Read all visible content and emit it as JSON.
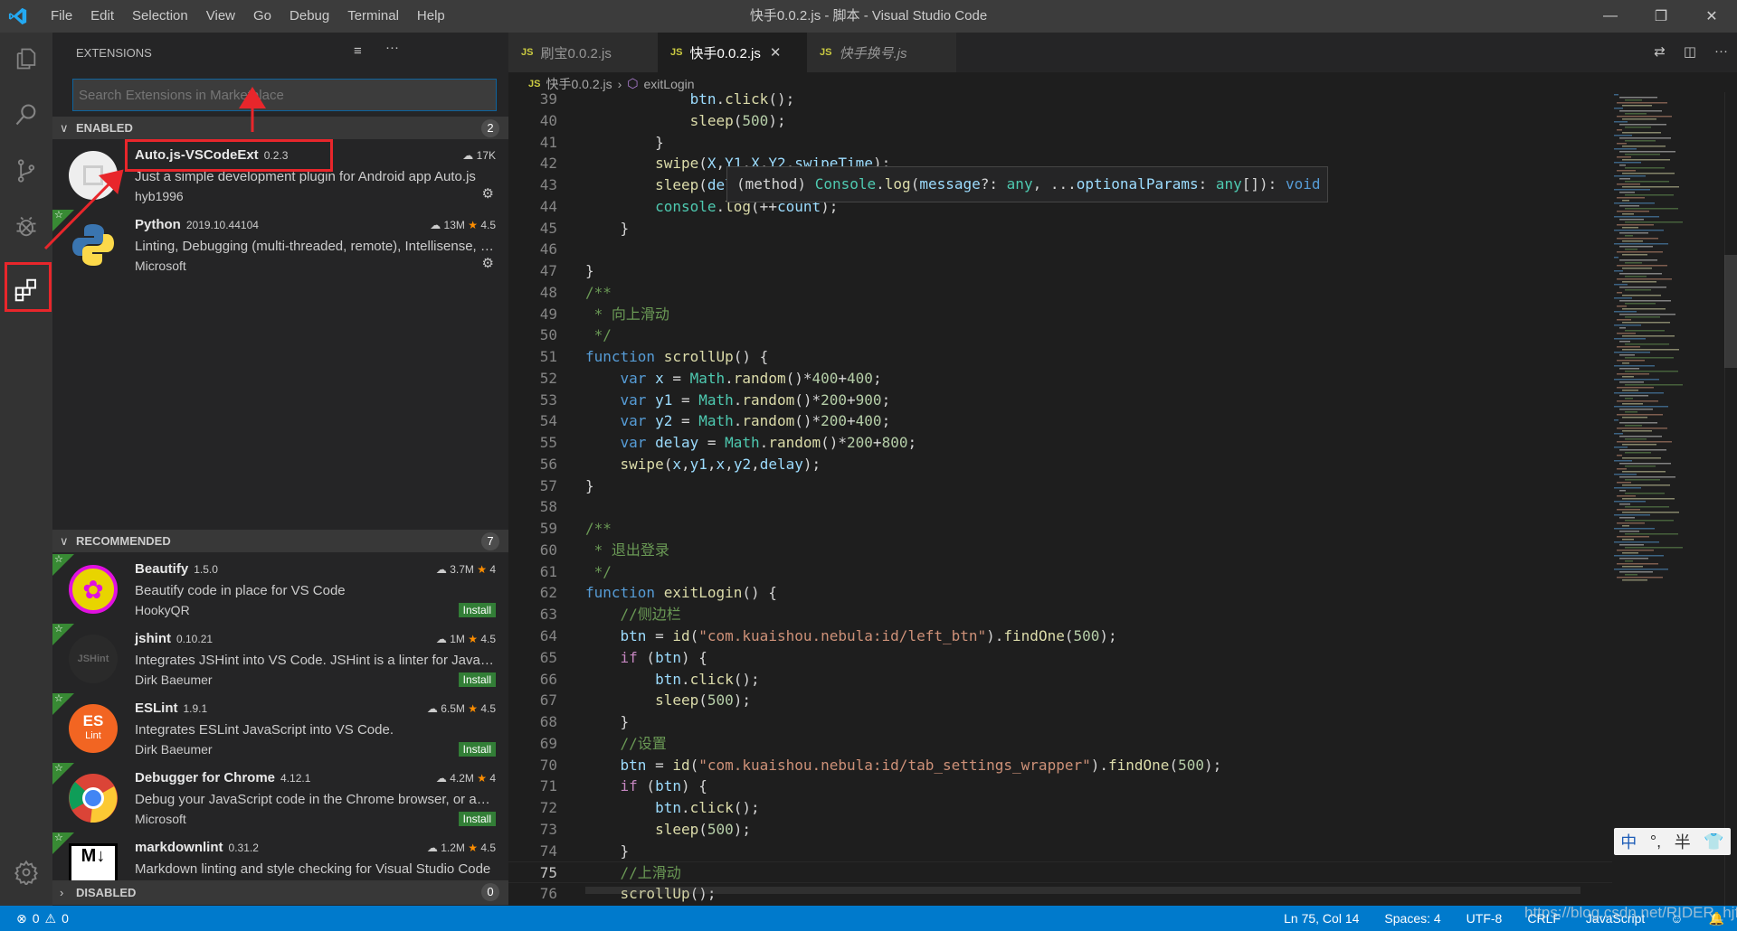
{
  "titlebar": {
    "menu": [
      "File",
      "Edit",
      "Selection",
      "View",
      "Go",
      "Debug",
      "Terminal",
      "Help"
    ],
    "title": "快手0.0.2.js - 脚本 - Visual Studio Code"
  },
  "sidebar": {
    "title": "EXTENSIONS",
    "search_placeholder": "Search Extensions in Marketplace",
    "enabled": {
      "label": "ENABLED",
      "count": "2",
      "items": [
        {
          "name": "Auto.js-VSCodeExt",
          "version": "0.2.3",
          "desc": "Just a simple development plugin for Android app Auto.js",
          "publisher": "hyb1996",
          "downloads": "17K",
          "rating": "",
          "action": "gear",
          "icon": "autojs",
          "recommended": false
        },
        {
          "name": "Python",
          "version": "2019.10.44104",
          "desc": "Linting, Debugging (multi-threaded, remote), Intellisense, code formatting",
          "publisher": "Microsoft",
          "downloads": "13M",
          "rating": "4.5",
          "action": "gear",
          "icon": "python",
          "recommended": true
        }
      ]
    },
    "recommended": {
      "label": "RECOMMENDED",
      "count": "7",
      "items": [
        {
          "name": "Beautify",
          "version": "1.5.0",
          "desc": "Beautify code in place for VS Code",
          "publisher": "HookyQR",
          "downloads": "3.7M",
          "rating": "4",
          "action": "Install",
          "icon": "beautify",
          "recommended": true
        },
        {
          "name": "jshint",
          "version": "0.10.21",
          "desc": "Integrates JSHint into VS Code. JSHint is a linter for JavaScript",
          "publisher": "Dirk Baeumer",
          "downloads": "1M",
          "rating": "4.5",
          "action": "Install",
          "icon": "jshint",
          "recommended": true
        },
        {
          "name": "ESLint",
          "version": "1.9.1",
          "desc": "Integrates ESLint JavaScript into VS Code.",
          "publisher": "Dirk Baeumer",
          "downloads": "6.5M",
          "rating": "4.5",
          "action": "Install",
          "icon": "eslint",
          "recommended": true
        },
        {
          "name": "Debugger for Chrome",
          "version": "4.12.1",
          "desc": "Debug your JavaScript code in the Chrome browser, or any other target",
          "publisher": "Microsoft",
          "downloads": "4.2M",
          "rating": "4",
          "action": "Install",
          "icon": "chrome",
          "recommended": true
        },
        {
          "name": "markdownlint",
          "version": "0.31.2",
          "desc": "Markdown linting and style checking for Visual Studio Code",
          "publisher": "",
          "downloads": "1.2M",
          "rating": "4.5",
          "action": "",
          "icon": "markdown",
          "recommended": true
        }
      ]
    },
    "disabled": {
      "label": "DISABLED",
      "count": "0"
    }
  },
  "editor": {
    "tabs": [
      {
        "label": "刷宝0.0.2.js",
        "active": false,
        "preview": false
      },
      {
        "label": "快手0.0.2.js",
        "active": true,
        "preview": false
      },
      {
        "label": "快手换号.js",
        "active": false,
        "preview": true
      }
    ],
    "breadcrumb": {
      "file": "快手0.0.2.js",
      "symbol": "exitLogin"
    },
    "current_line": 75,
    "tooltip": [
      [
        "p",
        "(method) "
      ],
      [
        "cl",
        "Console"
      ],
      [
        "p",
        "."
      ],
      [
        "f",
        "log"
      ],
      [
        "p",
        "("
      ],
      [
        "v",
        "message"
      ],
      [
        "p",
        "?: "
      ],
      [
        "cl",
        "any"
      ],
      [
        "p",
        ", ..."
      ],
      [
        "v",
        "optionalParams"
      ],
      [
        "p",
        ": "
      ],
      [
        "cl",
        "any"
      ],
      [
        "p",
        "[]): "
      ],
      [
        "k",
        "void"
      ]
    ],
    "lines": [
      {
        "n": 39,
        "t": [
          [
            "p",
            "            "
          ],
          [
            "v",
            "btn"
          ],
          [
            "p",
            "."
          ],
          [
            "f",
            "click"
          ],
          [
            "p",
            "();"
          ]
        ]
      },
      {
        "n": 40,
        "t": [
          [
            "p",
            "            "
          ],
          [
            "f",
            "sleep"
          ],
          [
            "p",
            "("
          ],
          [
            "n",
            "500"
          ],
          [
            "p",
            ");"
          ]
        ]
      },
      {
        "n": 41,
        "t": [
          [
            "p",
            "        }"
          ]
        ]
      },
      {
        "n": 42,
        "t": [
          [
            "p",
            "        "
          ],
          [
            "f",
            "swipe"
          ],
          [
            "p",
            "("
          ],
          [
            "v",
            "X"
          ],
          [
            "p",
            ","
          ],
          [
            "v",
            "Y1"
          ],
          [
            "p",
            ","
          ],
          [
            "v",
            "X"
          ],
          [
            "p",
            ","
          ],
          [
            "v",
            "Y2"
          ],
          [
            "p",
            ","
          ],
          [
            "v",
            "swipeTime"
          ],
          [
            "p",
            ");"
          ]
        ]
      },
      {
        "n": 43,
        "t": [
          [
            "p",
            "        "
          ],
          [
            "f",
            "sleep"
          ],
          [
            "p",
            "("
          ],
          [
            "v",
            "delay"
          ],
          [
            "p",
            ");"
          ]
        ]
      },
      {
        "n": 44,
        "t": [
          [
            "p",
            "        "
          ],
          [
            "cl",
            "console"
          ],
          [
            "p",
            "."
          ],
          [
            "f",
            "log"
          ],
          [
            "p",
            "(++"
          ],
          [
            "v",
            "count"
          ],
          [
            "p",
            ");"
          ]
        ]
      },
      {
        "n": 45,
        "t": [
          [
            "p",
            "    }"
          ]
        ]
      },
      {
        "n": 46,
        "t": []
      },
      {
        "n": 47,
        "t": [
          [
            "p",
            "}"
          ]
        ]
      },
      {
        "n": 48,
        "t": [
          [
            "cm",
            "/**"
          ]
        ]
      },
      {
        "n": 49,
        "t": [
          [
            "cm",
            " * 向上滑动"
          ]
        ]
      },
      {
        "n": 50,
        "t": [
          [
            "cm",
            " */"
          ]
        ]
      },
      {
        "n": 51,
        "t": [
          [
            "k",
            "function "
          ],
          [
            "f",
            "scrollUp"
          ],
          [
            "p",
            "() {"
          ]
        ]
      },
      {
        "n": 52,
        "t": [
          [
            "p",
            "    "
          ],
          [
            "k",
            "var "
          ],
          [
            "v",
            "x"
          ],
          [
            "p",
            " = "
          ],
          [
            "cl",
            "Math"
          ],
          [
            "p",
            "."
          ],
          [
            "f",
            "random"
          ],
          [
            "p",
            "()*"
          ],
          [
            "n",
            "400"
          ],
          [
            "p",
            "+"
          ],
          [
            "n",
            "400"
          ],
          [
            "p",
            ";"
          ]
        ]
      },
      {
        "n": 53,
        "t": [
          [
            "p",
            "    "
          ],
          [
            "k",
            "var "
          ],
          [
            "v",
            "y1"
          ],
          [
            "p",
            " = "
          ],
          [
            "cl",
            "Math"
          ],
          [
            "p",
            "."
          ],
          [
            "f",
            "random"
          ],
          [
            "p",
            "()*"
          ],
          [
            "n",
            "200"
          ],
          [
            "p",
            "+"
          ],
          [
            "n",
            "900"
          ],
          [
            "p",
            ";"
          ]
        ]
      },
      {
        "n": 54,
        "t": [
          [
            "p",
            "    "
          ],
          [
            "k",
            "var "
          ],
          [
            "v",
            "y2"
          ],
          [
            "p",
            " = "
          ],
          [
            "cl",
            "Math"
          ],
          [
            "p",
            "."
          ],
          [
            "f",
            "random"
          ],
          [
            "p",
            "()*"
          ],
          [
            "n",
            "200"
          ],
          [
            "p",
            "+"
          ],
          [
            "n",
            "400"
          ],
          [
            "p",
            ";"
          ]
        ]
      },
      {
        "n": 55,
        "t": [
          [
            "p",
            "    "
          ],
          [
            "k",
            "var "
          ],
          [
            "v",
            "delay"
          ],
          [
            "p",
            " = "
          ],
          [
            "cl",
            "Math"
          ],
          [
            "p",
            "."
          ],
          [
            "f",
            "random"
          ],
          [
            "p",
            "()*"
          ],
          [
            "n",
            "200"
          ],
          [
            "p",
            "+"
          ],
          [
            "n",
            "800"
          ],
          [
            "p",
            ";"
          ]
        ]
      },
      {
        "n": 56,
        "t": [
          [
            "p",
            "    "
          ],
          [
            "f",
            "swipe"
          ],
          [
            "p",
            "("
          ],
          [
            "v",
            "x"
          ],
          [
            "p",
            ","
          ],
          [
            "v",
            "y1"
          ],
          [
            "p",
            ","
          ],
          [
            "v",
            "x"
          ],
          [
            "p",
            ","
          ],
          [
            "v",
            "y2"
          ],
          [
            "p",
            ","
          ],
          [
            "v",
            "delay"
          ],
          [
            "p",
            ");"
          ]
        ]
      },
      {
        "n": 57,
        "t": [
          [
            "p",
            "}"
          ]
        ]
      },
      {
        "n": 58,
        "t": []
      },
      {
        "n": 59,
        "t": [
          [
            "cm",
            "/**"
          ]
        ]
      },
      {
        "n": 60,
        "t": [
          [
            "cm",
            " * 退出登录"
          ]
        ]
      },
      {
        "n": 61,
        "t": [
          [
            "cm",
            " */"
          ]
        ]
      },
      {
        "n": 62,
        "t": [
          [
            "k",
            "function "
          ],
          [
            "f",
            "exitLogin"
          ],
          [
            "p",
            "() {"
          ]
        ]
      },
      {
        "n": 63,
        "t": [
          [
            "p",
            "    "
          ],
          [
            "cm",
            "//侧边栏"
          ]
        ]
      },
      {
        "n": 64,
        "t": [
          [
            "p",
            "    "
          ],
          [
            "v",
            "btn"
          ],
          [
            "p",
            " = "
          ],
          [
            "f",
            "id"
          ],
          [
            "p",
            "("
          ],
          [
            "s",
            "\"com.kuaishou.nebula:id/left_btn\""
          ],
          [
            "p",
            ")."
          ],
          [
            "f",
            "findOne"
          ],
          [
            "p",
            "("
          ],
          [
            "n",
            "500"
          ],
          [
            "p",
            ");"
          ]
        ]
      },
      {
        "n": 65,
        "t": [
          [
            "p",
            "    "
          ],
          [
            "c",
            "if"
          ],
          [
            "p",
            " ("
          ],
          [
            "v",
            "btn"
          ],
          [
            "p",
            ") {"
          ]
        ]
      },
      {
        "n": 66,
        "t": [
          [
            "p",
            "        "
          ],
          [
            "v",
            "btn"
          ],
          [
            "p",
            "."
          ],
          [
            "f",
            "click"
          ],
          [
            "p",
            "();"
          ]
        ]
      },
      {
        "n": 67,
        "t": [
          [
            "p",
            "        "
          ],
          [
            "f",
            "sleep"
          ],
          [
            "p",
            "("
          ],
          [
            "n",
            "500"
          ],
          [
            "p",
            ");"
          ]
        ]
      },
      {
        "n": 68,
        "t": [
          [
            "p",
            "    }"
          ]
        ]
      },
      {
        "n": 69,
        "t": [
          [
            "p",
            "    "
          ],
          [
            "cm",
            "//设置"
          ]
        ]
      },
      {
        "n": 70,
        "t": [
          [
            "p",
            "    "
          ],
          [
            "v",
            "btn"
          ],
          [
            "p",
            " = "
          ],
          [
            "f",
            "id"
          ],
          [
            "p",
            "("
          ],
          [
            "s",
            "\"com.kuaishou.nebula:id/tab_settings_wrapper\""
          ],
          [
            "p",
            ")."
          ],
          [
            "f",
            "findOne"
          ],
          [
            "p",
            "("
          ],
          [
            "n",
            "500"
          ],
          [
            "p",
            ");"
          ]
        ]
      },
      {
        "n": 71,
        "t": [
          [
            "p",
            "    "
          ],
          [
            "c",
            "if"
          ],
          [
            "p",
            " ("
          ],
          [
            "v",
            "btn"
          ],
          [
            "p",
            ") {"
          ]
        ]
      },
      {
        "n": 72,
        "t": [
          [
            "p",
            "        "
          ],
          [
            "v",
            "btn"
          ],
          [
            "p",
            "."
          ],
          [
            "f",
            "click"
          ],
          [
            "p",
            "();"
          ]
        ]
      },
      {
        "n": 73,
        "t": [
          [
            "p",
            "        "
          ],
          [
            "f",
            "sleep"
          ],
          [
            "p",
            "("
          ],
          [
            "n",
            "500"
          ],
          [
            "p",
            ");"
          ]
        ]
      },
      {
        "n": 74,
        "t": [
          [
            "p",
            "    }"
          ]
        ]
      },
      {
        "n": 75,
        "t": [
          [
            "p",
            "    "
          ],
          [
            "cm",
            "//上滑动"
          ]
        ]
      },
      {
        "n": 76,
        "t": [
          [
            "p",
            "    "
          ],
          [
            "f",
            "scrollUp"
          ],
          [
            "p",
            "();"
          ]
        ]
      }
    ]
  },
  "statusbar": {
    "errors": "0",
    "warnings": "0",
    "position": "Ln 75, Col 14",
    "spaces": "Spaces: 4",
    "encoding": "UTF-8",
    "eol": "CRLF",
    "language": "JavaScript"
  },
  "watermark": "https://blog.csdn.net/RIDER_hjf",
  "ime": {
    "lang": "中",
    "punct": "°,",
    "width": "半"
  },
  "colors": {
    "statusbar": "#007acc",
    "annotation": "#e8262b",
    "install": "#327e36"
  }
}
